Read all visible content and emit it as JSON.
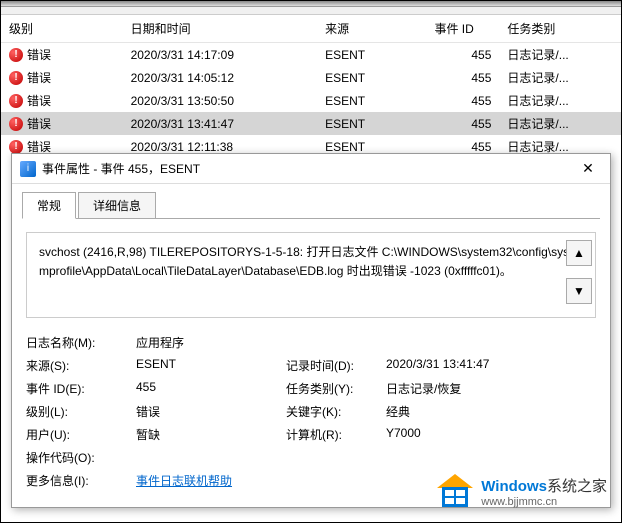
{
  "table": {
    "headers": {
      "level": "级别",
      "datetime": "日期和时间",
      "source": "来源",
      "eventid": "事件 ID",
      "category": "任务类别"
    },
    "rows": [
      {
        "level": "错误",
        "datetime": "2020/3/31 14:17:09",
        "source": "ESENT",
        "eventid": "455",
        "category": "日志记录/...",
        "selected": false
      },
      {
        "level": "错误",
        "datetime": "2020/3/31 14:05:12",
        "source": "ESENT",
        "eventid": "455",
        "category": "日志记录/...",
        "selected": false
      },
      {
        "level": "错误",
        "datetime": "2020/3/31 13:50:50",
        "source": "ESENT",
        "eventid": "455",
        "category": "日志记录/...",
        "selected": false
      },
      {
        "level": "错误",
        "datetime": "2020/3/31 13:41:47",
        "source": "ESENT",
        "eventid": "455",
        "category": "日志记录/...",
        "selected": true
      },
      {
        "level": "错误",
        "datetime": "2020/3/31 12:11:38",
        "source": "ESENT",
        "eventid": "455",
        "category": "日志记录/...",
        "selected": false
      }
    ]
  },
  "dialog": {
    "title": "事件属性 - 事件 455，ESENT",
    "tabs": {
      "general": "常规",
      "details": "详细信息"
    },
    "description": "svchost (2416,R,98) TILEREPOSITORYS-1-5-18: 打开日志文件 C:\\WINDOWS\\system32\\config\\systemprofile\\AppData\\Local\\TileDataLayer\\Database\\EDB.log 时出现错误 -1023 (0xfffffc01)。",
    "props": {
      "log_name_label": "日志名称(M):",
      "log_name_value": "应用程序",
      "source_label": "来源(S):",
      "source_value": "ESENT",
      "recorded_label": "记录时间(D):",
      "recorded_value": "2020/3/31 13:41:47",
      "eventid_label": "事件 ID(E):",
      "eventid_value": "455",
      "category_label": "任务类别(Y):",
      "category_value": "日志记录/恢复",
      "level_label": "级别(L):",
      "level_value": "错误",
      "keywords_label": "关键字(K):",
      "keywords_value": "经典",
      "user_label": "用户(U):",
      "user_value": "暂缺",
      "computer_label": "计算机(R):",
      "computer_value": "Y7000",
      "opcode_label": "操作代码(O):",
      "moreinfo_label": "更多信息(I):",
      "help_link": "事件日志联机帮助"
    }
  },
  "watermark": {
    "brand_blue": "Windows",
    "brand_rest": "系统之家",
    "url": "www.bjjmmc.cn"
  },
  "icons": {
    "error_glyph": "!",
    "close_glyph": "✕",
    "up_glyph": "▲",
    "down_glyph": "▼",
    "dialog_glyph": "i"
  }
}
